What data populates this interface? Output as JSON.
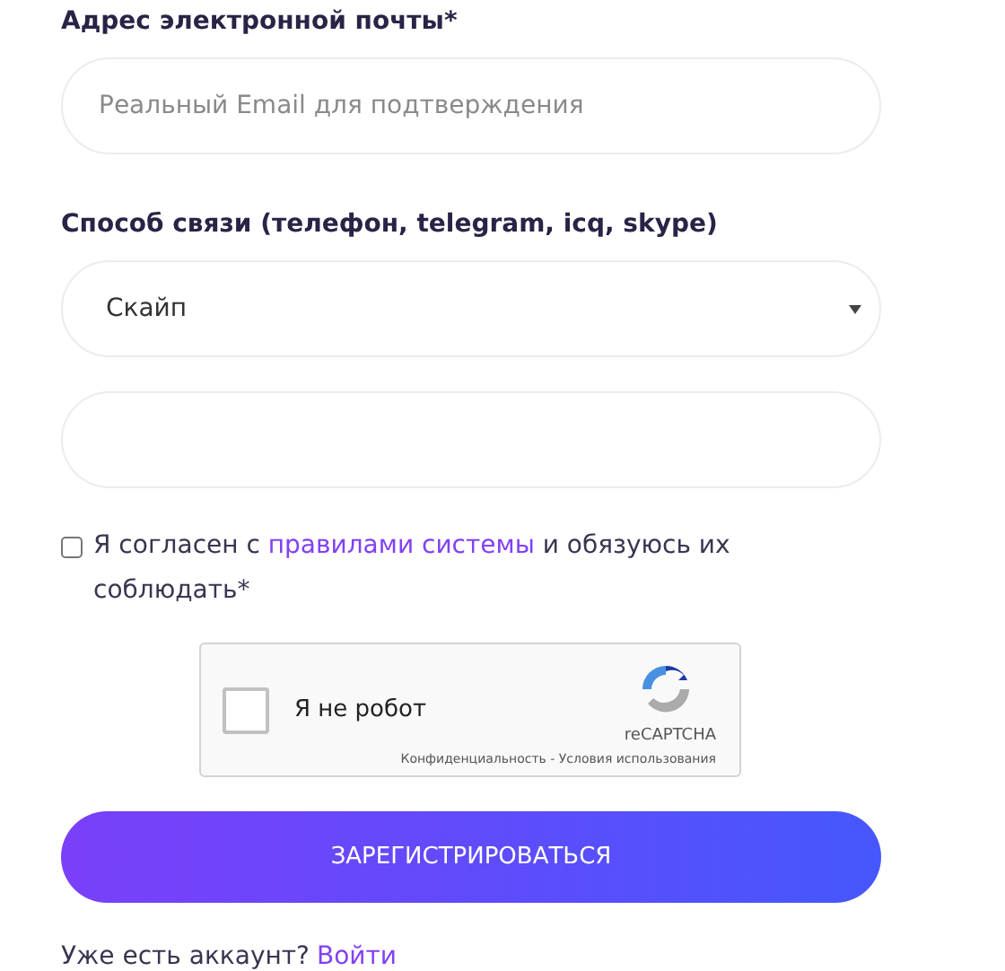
{
  "email": {
    "label": "Адрес электронной почты*",
    "placeholder": "Реальный Email для подтверждения"
  },
  "contact": {
    "label": "Способ связи (телефон, telegram, icq, skype)",
    "value": "Скайп"
  },
  "contact_detail": {
    "kind": "text"
  },
  "agreement": {
    "checked": false,
    "text_before": "Я согласен с ",
    "link": "правилами системы",
    "text_after": " и обязуюсь их соблюдать*"
  },
  "captcha": {
    "checked": false,
    "label": "Я не робот",
    "brand": "reCAPTCHA",
    "links": "Конфиденциальность - Условия использования"
  },
  "submit": "ЗАРЕГИСТРИРОВАТЬСЯ",
  "footer": {
    "text": "Уже есть аккаунт?",
    "link": "Войти"
  }
}
